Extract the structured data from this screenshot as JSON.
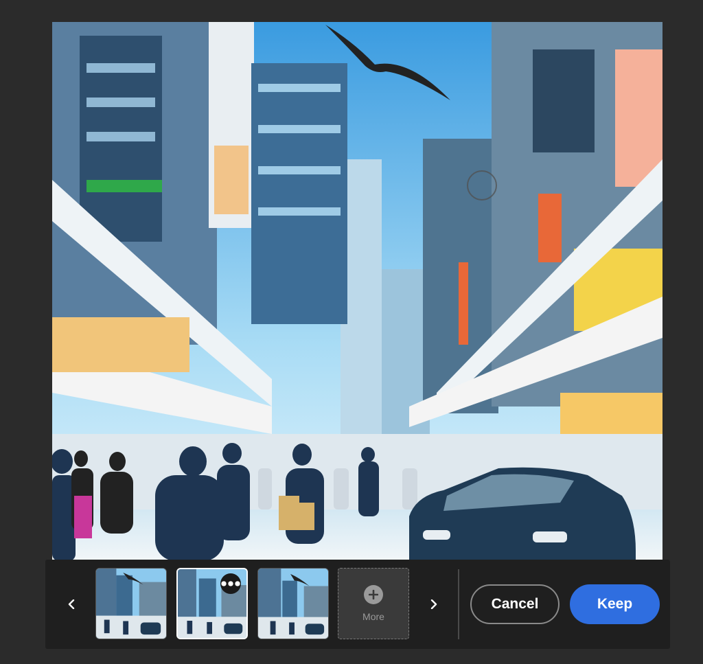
{
  "image": {
    "alt_icon": "street-scene-image"
  },
  "variations": {
    "prev_icon": "chevron-left-icon",
    "next_icon": "chevron-right-icon",
    "thumbnails": [
      {
        "icon": "variation-thumbnail-icon",
        "selected": false
      },
      {
        "icon": "variation-thumbnail-icon",
        "selected": true,
        "menu_icon": "more-options-icon"
      },
      {
        "icon": "variation-thumbnail-icon",
        "selected": false
      }
    ],
    "more_label": "More",
    "more_icon": "plus-circle-icon"
  },
  "actions": {
    "cancel_label": "Cancel",
    "keep_label": "Keep"
  },
  "colors": {
    "background": "#2b2b2b",
    "bar": "#1f1f1f",
    "accent": "#2f6ee0"
  }
}
